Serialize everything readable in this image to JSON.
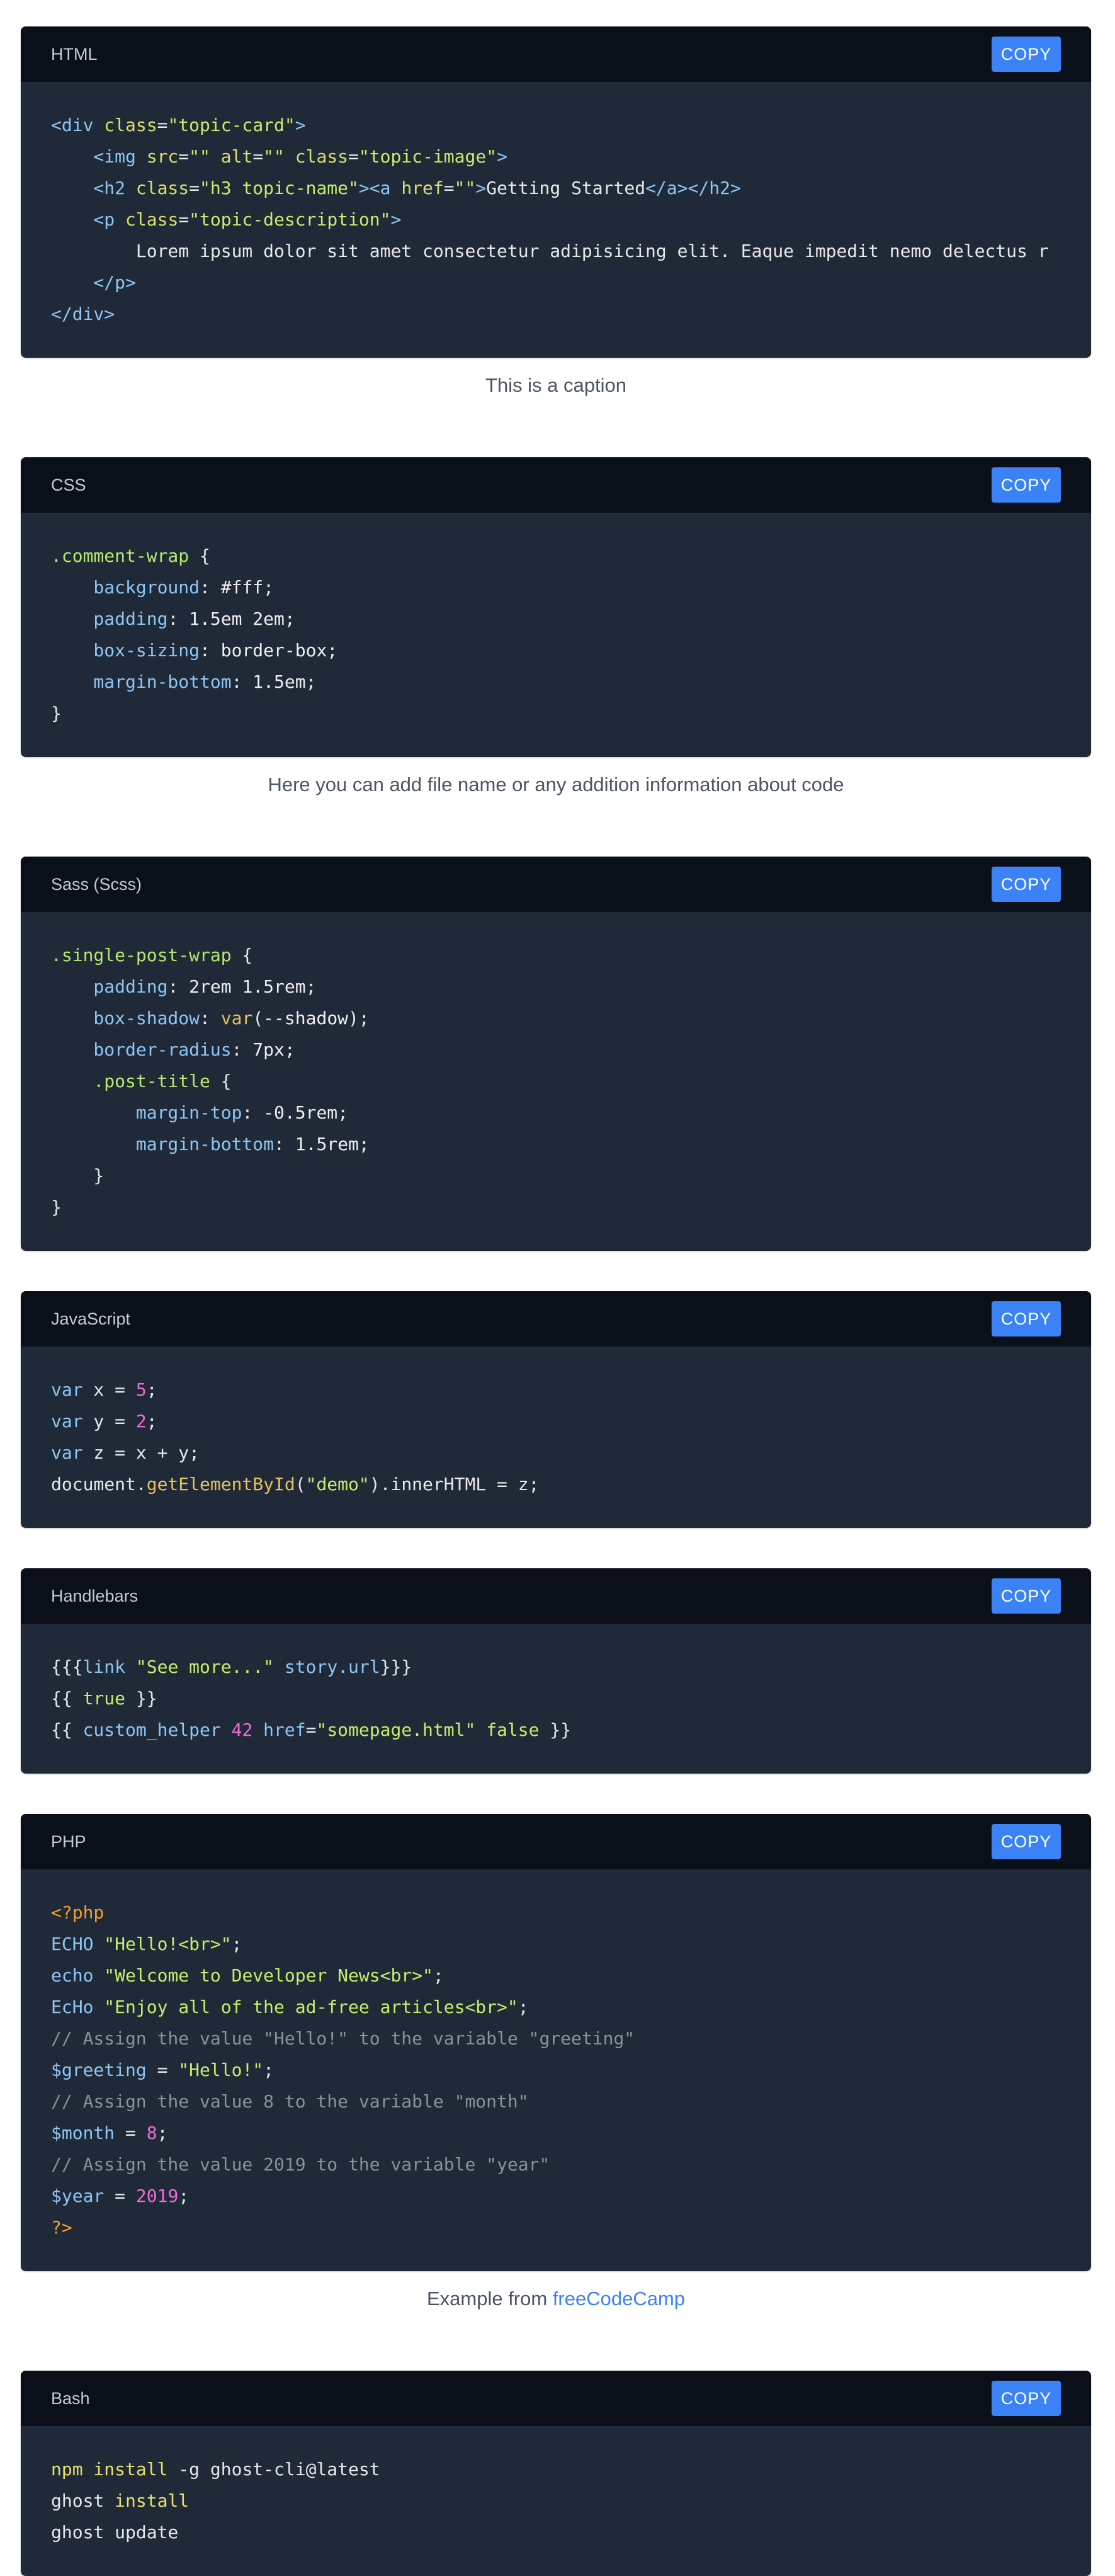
{
  "copy_label": "COPY",
  "blocks": [
    {
      "lang": "HTML",
      "caption": "This is a caption",
      "lines": [
        [
          [
            "tag",
            "<div "
          ],
          [
            "attr",
            "class"
          ],
          [
            "punc",
            "="
          ],
          [
            "str",
            "\"topic-card\""
          ],
          [
            "tag",
            ">"
          ]
        ],
        [
          [
            "tag",
            "    <img "
          ],
          [
            "attr",
            "src"
          ],
          [
            "punc",
            "="
          ],
          [
            "str",
            "\"\" "
          ],
          [
            "attr",
            "alt"
          ],
          [
            "punc",
            "="
          ],
          [
            "str",
            "\"\" "
          ],
          [
            "attr",
            "class"
          ],
          [
            "punc",
            "="
          ],
          [
            "str",
            "\"topic-image\""
          ],
          [
            "tag",
            ">"
          ]
        ],
        [
          [
            "tag",
            "    <h2 "
          ],
          [
            "attr",
            "class"
          ],
          [
            "punc",
            "="
          ],
          [
            "str",
            "\"h3 topic-name\""
          ],
          [
            "tag",
            "><a "
          ],
          [
            "attr",
            "href"
          ],
          [
            "punc",
            "="
          ],
          [
            "str",
            "\"\""
          ],
          [
            "tag",
            ">"
          ],
          [
            "txt",
            "Getting Started"
          ],
          [
            "tag",
            "</a></h2>"
          ]
        ],
        [
          [
            "tag",
            "    <p "
          ],
          [
            "attr",
            "class"
          ],
          [
            "punc",
            "="
          ],
          [
            "str",
            "\"topic-description\""
          ],
          [
            "tag",
            ">"
          ]
        ],
        [
          [
            "txt",
            "        Lorem ipsum dolor sit amet consectetur adipisicing elit. Eaque impedit nemo delectus r"
          ]
        ],
        [
          [
            "tag",
            "    </p>"
          ]
        ],
        [
          [
            "tag",
            "</div>"
          ]
        ]
      ]
    },
    {
      "lang": "CSS",
      "caption": "Here you can add file name or any addition information about code",
      "lines": [
        [
          [
            "sel",
            ".comment-wrap"
          ],
          [
            "punc",
            " {"
          ]
        ],
        [
          [
            "prop",
            "    background"
          ],
          [
            "punc",
            ": "
          ],
          [
            "val",
            "#fff"
          ],
          [
            "punc",
            ";"
          ]
        ],
        [
          [
            "prop",
            "    padding"
          ],
          [
            "punc",
            ": "
          ],
          [
            "val",
            "1.5em 2em"
          ],
          [
            "punc",
            ";"
          ]
        ],
        [
          [
            "prop",
            "    box-sizing"
          ],
          [
            "punc",
            ": "
          ],
          [
            "val",
            "border-box"
          ],
          [
            "punc",
            ";"
          ]
        ],
        [
          [
            "prop",
            "    margin-bottom"
          ],
          [
            "punc",
            ": "
          ],
          [
            "val",
            "1.5em"
          ],
          [
            "punc",
            ";"
          ]
        ],
        [
          [
            "punc",
            "}"
          ]
        ]
      ]
    },
    {
      "lang": "Sass (Scss)",
      "caption": "",
      "lines": [
        [
          [
            "sel",
            ".single-post-wrap"
          ],
          [
            "punc",
            " {"
          ]
        ],
        [
          [
            "prop",
            "    padding"
          ],
          [
            "punc",
            ": "
          ],
          [
            "val",
            "2rem 1.5rem"
          ],
          [
            "punc",
            ";"
          ]
        ],
        [
          [
            "prop",
            "    box-shadow"
          ],
          [
            "punc",
            ": "
          ],
          [
            "fn",
            "var"
          ],
          [
            "punc",
            "("
          ],
          [
            "val",
            "--shadow"
          ],
          [
            "punc",
            ");"
          ]
        ],
        [
          [
            "prop",
            "    border-radius"
          ],
          [
            "punc",
            ": "
          ],
          [
            "val",
            "7px"
          ],
          [
            "punc",
            ";"
          ]
        ],
        [
          [
            "sel",
            "    .post-title"
          ],
          [
            "punc",
            " {"
          ]
        ],
        [
          [
            "prop",
            "        margin-top"
          ],
          [
            "punc",
            ": "
          ],
          [
            "val",
            "-0.5rem"
          ],
          [
            "punc",
            ";"
          ]
        ],
        [
          [
            "prop",
            "        margin-bottom"
          ],
          [
            "punc",
            ": "
          ],
          [
            "val",
            "1.5rem"
          ],
          [
            "punc",
            ";"
          ]
        ],
        [
          [
            "punc",
            "    }"
          ]
        ],
        [
          [
            "punc",
            "}"
          ]
        ]
      ]
    },
    {
      "lang": "JavaScript",
      "caption": "",
      "lines": [
        [
          [
            "kw",
            "var"
          ],
          [
            "txt",
            " x = "
          ],
          [
            "num",
            "5"
          ],
          [
            "punc",
            ";"
          ]
        ],
        [
          [
            "kw",
            "var"
          ],
          [
            "txt",
            " y = "
          ],
          [
            "num",
            "2"
          ],
          [
            "punc",
            ";"
          ]
        ],
        [
          [
            "kw",
            "var"
          ],
          [
            "txt",
            " z = x + y;"
          ]
        ],
        [
          [
            "txt",
            "document."
          ],
          [
            "fn",
            "getElementById"
          ],
          [
            "punc",
            "("
          ],
          [
            "str",
            "\"demo\""
          ],
          [
            "punc",
            ")"
          ],
          [
            "txt",
            ".innerHTML = z;"
          ]
        ]
      ]
    },
    {
      "lang": "Handlebars",
      "caption": "",
      "lines": [
        [
          [
            "punc",
            "{{{"
          ],
          [
            "var",
            "link "
          ],
          [
            "str",
            "\"See more...\""
          ],
          [
            "var",
            " story.url"
          ],
          [
            "punc",
            "}}}"
          ]
        ],
        [
          [
            "punc",
            "{{ "
          ],
          [
            "bool",
            "true"
          ],
          [
            "punc",
            " }}"
          ]
        ],
        [
          [
            "punc",
            "{{ "
          ],
          [
            "var",
            "custom_helper "
          ],
          [
            "num",
            "42"
          ],
          [
            "var",
            " href"
          ],
          [
            "punc",
            "="
          ],
          [
            "str",
            "\"somepage.html\""
          ],
          [
            "bool",
            " false"
          ],
          [
            "punc",
            " }}"
          ]
        ]
      ]
    },
    {
      "lang": "PHP",
      "caption": "Example from ",
      "caption_link": "freeCodeCamp",
      "lines": [
        [
          [
            "php",
            "<?php"
          ]
        ],
        [
          [
            "kw",
            "ECHO "
          ],
          [
            "str",
            "\"Hello!<br>\""
          ],
          [
            "punc",
            ";"
          ]
        ],
        [
          [
            "kw",
            "echo "
          ],
          [
            "str",
            "\"Welcome to Developer News<br>\""
          ],
          [
            "punc",
            ";"
          ]
        ],
        [
          [
            "kw",
            "EcHo "
          ],
          [
            "str",
            "\"Enjoy all of the ad-free articles<br>\""
          ],
          [
            "punc",
            ";"
          ]
        ],
        [
          [
            "cmt",
            "// Assign the value \"Hello!\" to the variable \"greeting\""
          ]
        ],
        [
          [
            "var",
            "$greeting"
          ],
          [
            "txt",
            " = "
          ],
          [
            "str",
            "\"Hello!\""
          ],
          [
            "punc",
            ";"
          ]
        ],
        [
          [
            "cmt",
            "// Assign the value 8 to the variable \"month\""
          ]
        ],
        [
          [
            "var",
            "$month"
          ],
          [
            "txt",
            " = "
          ],
          [
            "num",
            "8"
          ],
          [
            "punc",
            ";"
          ]
        ],
        [
          [
            "cmt",
            "// Assign the value 2019 to the variable \"year\""
          ]
        ],
        [
          [
            "var",
            "$year"
          ],
          [
            "txt",
            " = "
          ],
          [
            "num",
            "2019"
          ],
          [
            "punc",
            ";"
          ]
        ],
        [
          [
            "php",
            "?>"
          ]
        ]
      ]
    },
    {
      "lang": "Bash",
      "caption": "",
      "lines": [
        [
          [
            "cmd",
            "npm"
          ],
          [
            "cmd",
            " install"
          ],
          [
            "txt",
            " -g ghost-cli@latest"
          ]
        ],
        [
          [
            "txt",
            "ghost "
          ],
          [
            "cmd",
            "install"
          ]
        ],
        [
          [
            "txt",
            "ghost update"
          ]
        ]
      ]
    }
  ],
  "colors": {
    "header_bg": "#0a0f1a",
    "body_bg": "#1f2937",
    "accent": "#3b82f6"
  }
}
